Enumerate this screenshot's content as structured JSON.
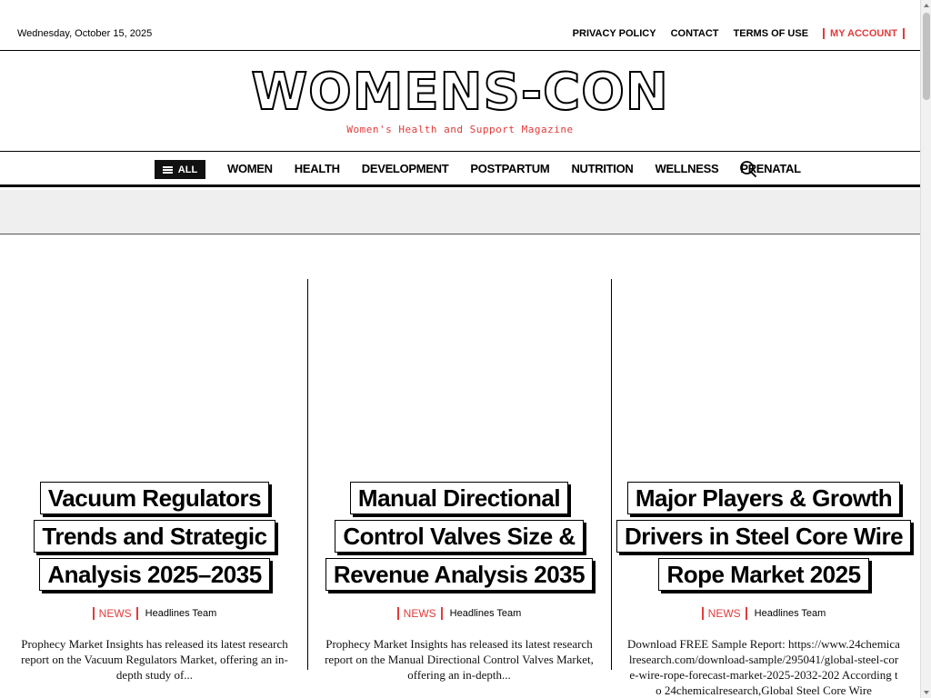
{
  "header": {
    "date": "Wednesday, October 15, 2025",
    "links": [
      "PRIVACY POLICY",
      "CONTACT",
      "TERMS OF USE"
    ],
    "account": "MY ACCOUNT"
  },
  "brand": {
    "logo": "WOMENS-CON",
    "tagline": "Women's Health and Support Magazine",
    "accent_color": "#e23b3b"
  },
  "nav": {
    "all_label": "ALL",
    "items": [
      "WOMEN",
      "HEALTH",
      "DEVELOPMENT",
      "POSTPARTUM",
      "NUTRITION",
      "WELLNESS",
      "PRENATAL"
    ],
    "search_icon": "search-icon"
  },
  "articles": [
    {
      "title_lines": [
        "Vacuum Regulators",
        "Trends and Strategic",
        "Analysis 2025–2035"
      ],
      "category": "NEWS",
      "author": "Headlines Team",
      "excerpt": "Prophecy Market Insights has released its latest research report on the Vacuum Regulators Market, offering an in-depth study of..."
    },
    {
      "title_lines": [
        "Manual Directional",
        "Control Valves Size &",
        "Revenue Analysis 2035"
      ],
      "category": "NEWS",
      "author": "Headlines Team",
      "excerpt": "Prophecy Market Insights has released its latest research report on the Manual Directional Control Valves Market, offering an in-depth..."
    },
    {
      "title_lines": [
        "Major Players & Growth",
        "Drivers in Steel Core Wire",
        "Rope Market 2025"
      ],
      "category": "NEWS",
      "author": "Headlines Team",
      "excerpt": "Download FREE Sample Report: https://www.24chemicalresearch.com/download-sample/295041/global-steel-core-wire-rope-forecast-market-2025-2032-202 According to 24chemicalresearch,Global Steel Core Wire"
    }
  ]
}
